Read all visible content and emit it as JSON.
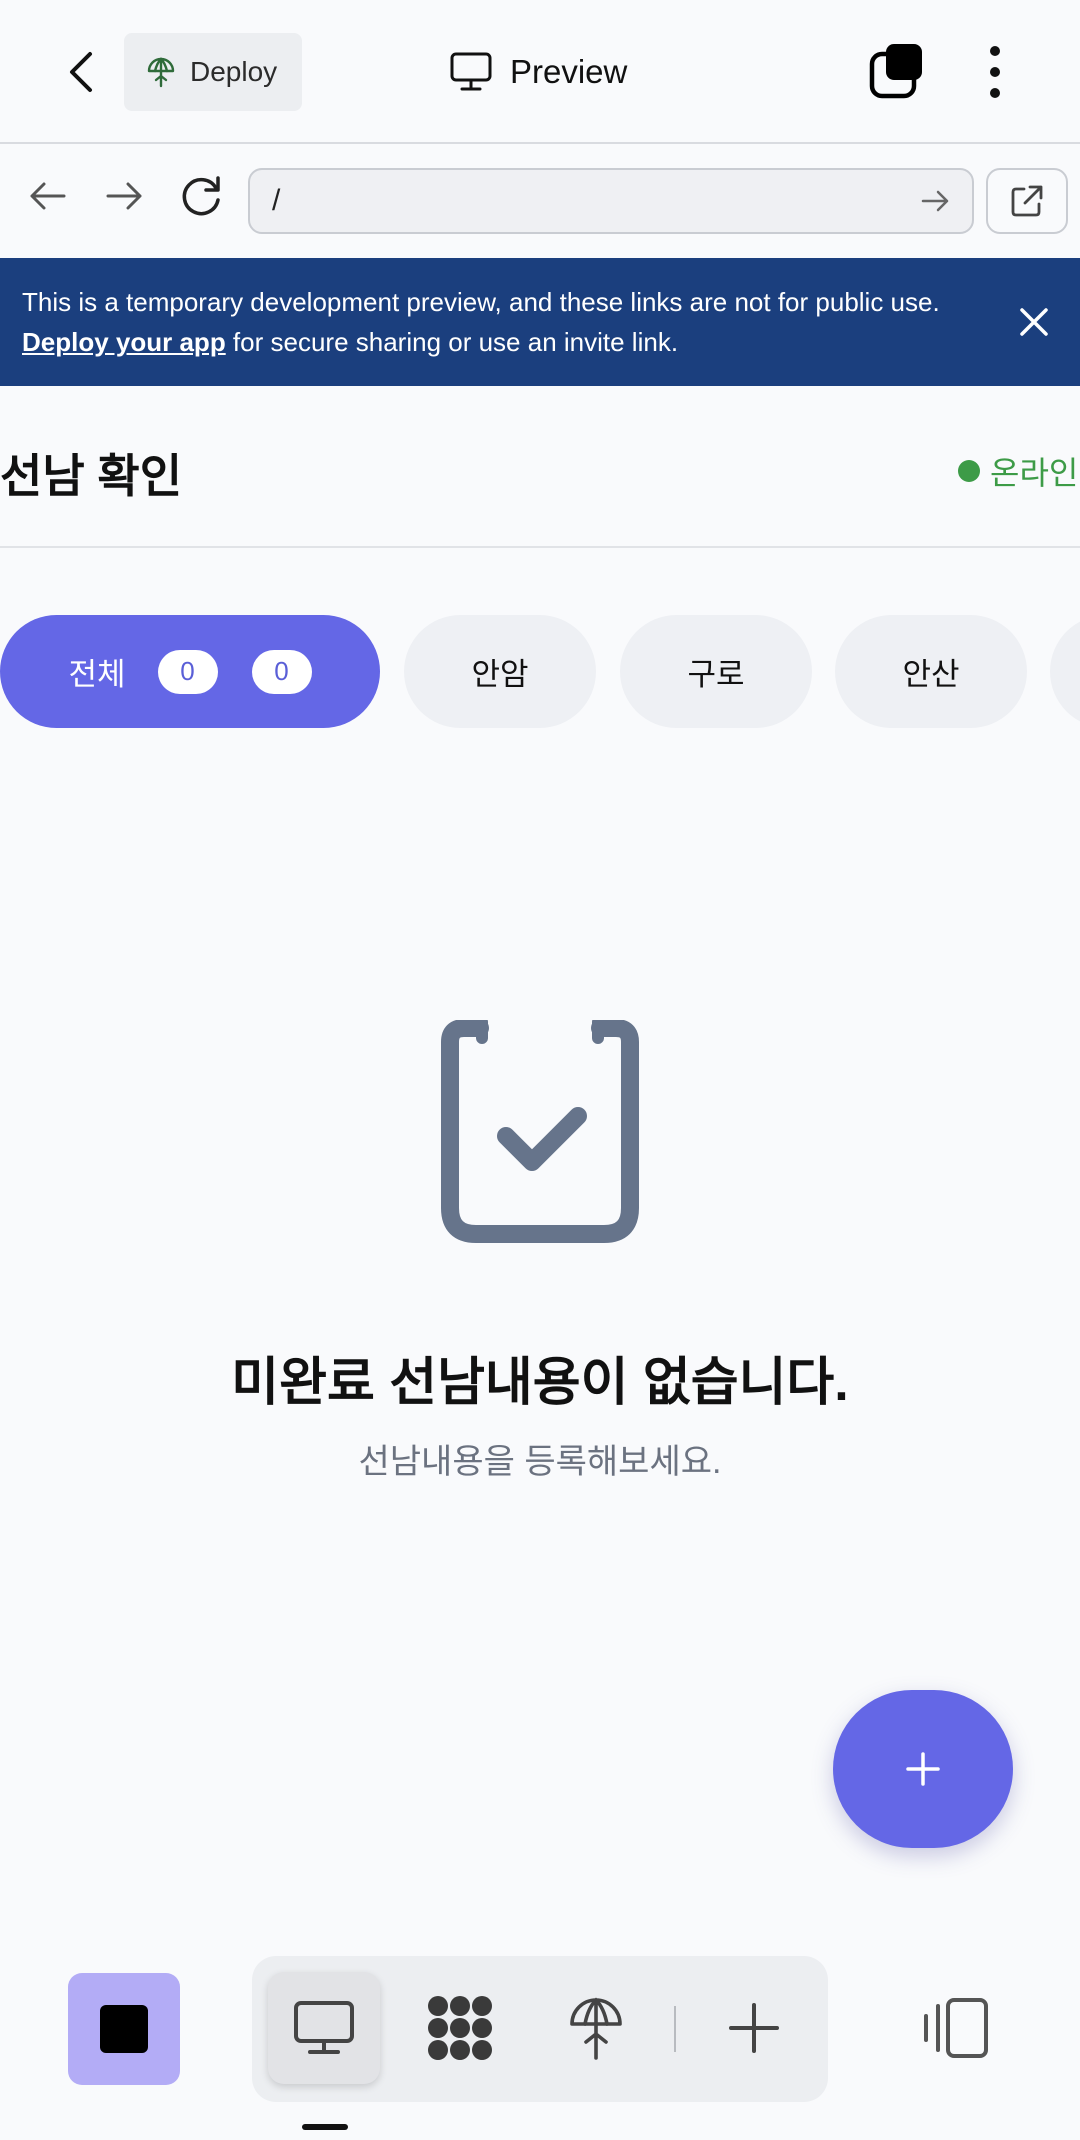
{
  "topbar": {
    "deploy_label": "Deploy",
    "preview_label": "Preview"
  },
  "urlbar": {
    "url_value": "/"
  },
  "banner": {
    "text_before": "This is a temporary development preview, and these links are not for public use. ",
    "link_text": "Deploy your app",
    "text_after": " for secure sharing or use an invite link."
  },
  "header": {
    "title": "선남 확인",
    "status": "온라인",
    "status_color": "#3d9b47"
  },
  "filters": {
    "all_label": "전체",
    "all_count_1": "0",
    "all_count_2": "0",
    "items": [
      "안암",
      "구로",
      "안산"
    ]
  },
  "empty_state": {
    "icon": "clipboard-check-icon",
    "title": "미완료 선남내용이 없습니다.",
    "subtitle": "선남내용을 등록해보세요."
  },
  "fab": {
    "icon": "plus-icon"
  },
  "colors": {
    "accent": "#6467e6",
    "banner_bg": "#1b3f7e",
    "stop_bg": "#b3acf6"
  },
  "bottombar": {
    "tools": [
      "monitor-icon",
      "apps-icon",
      "deploy-icon",
      "plus-icon"
    ]
  }
}
